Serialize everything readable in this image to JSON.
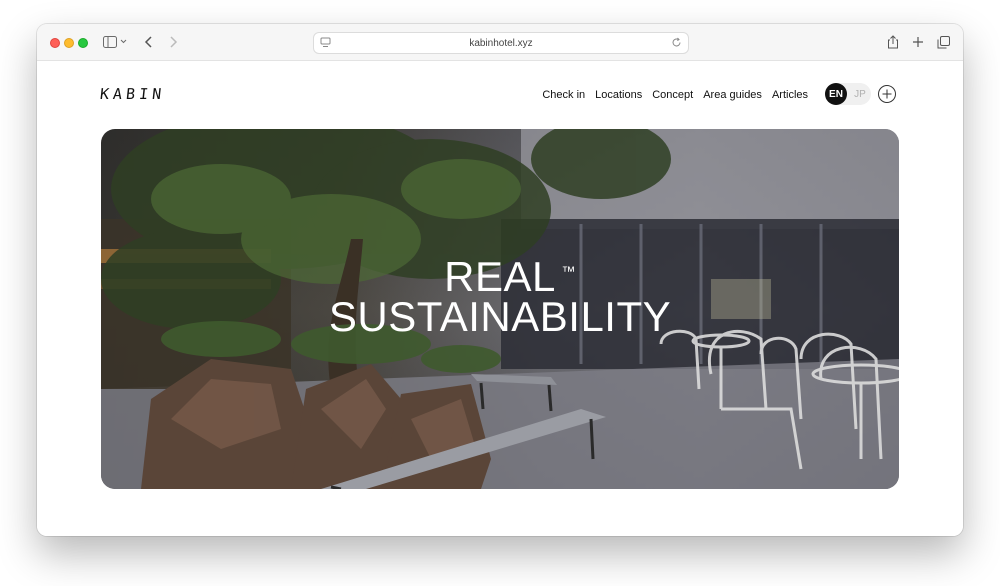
{
  "browser": {
    "url": "kabinhotel.xyz"
  },
  "site": {
    "logo": "KABIN",
    "nav": [
      "Check in",
      "Locations",
      "Concept",
      "Area guides",
      "Articles"
    ],
    "languages": {
      "active": "EN",
      "inactive": "JP"
    }
  },
  "hero": {
    "title_line1": "REAL",
    "trademark": "™",
    "title_line2": "SUSTAINABILITY"
  }
}
